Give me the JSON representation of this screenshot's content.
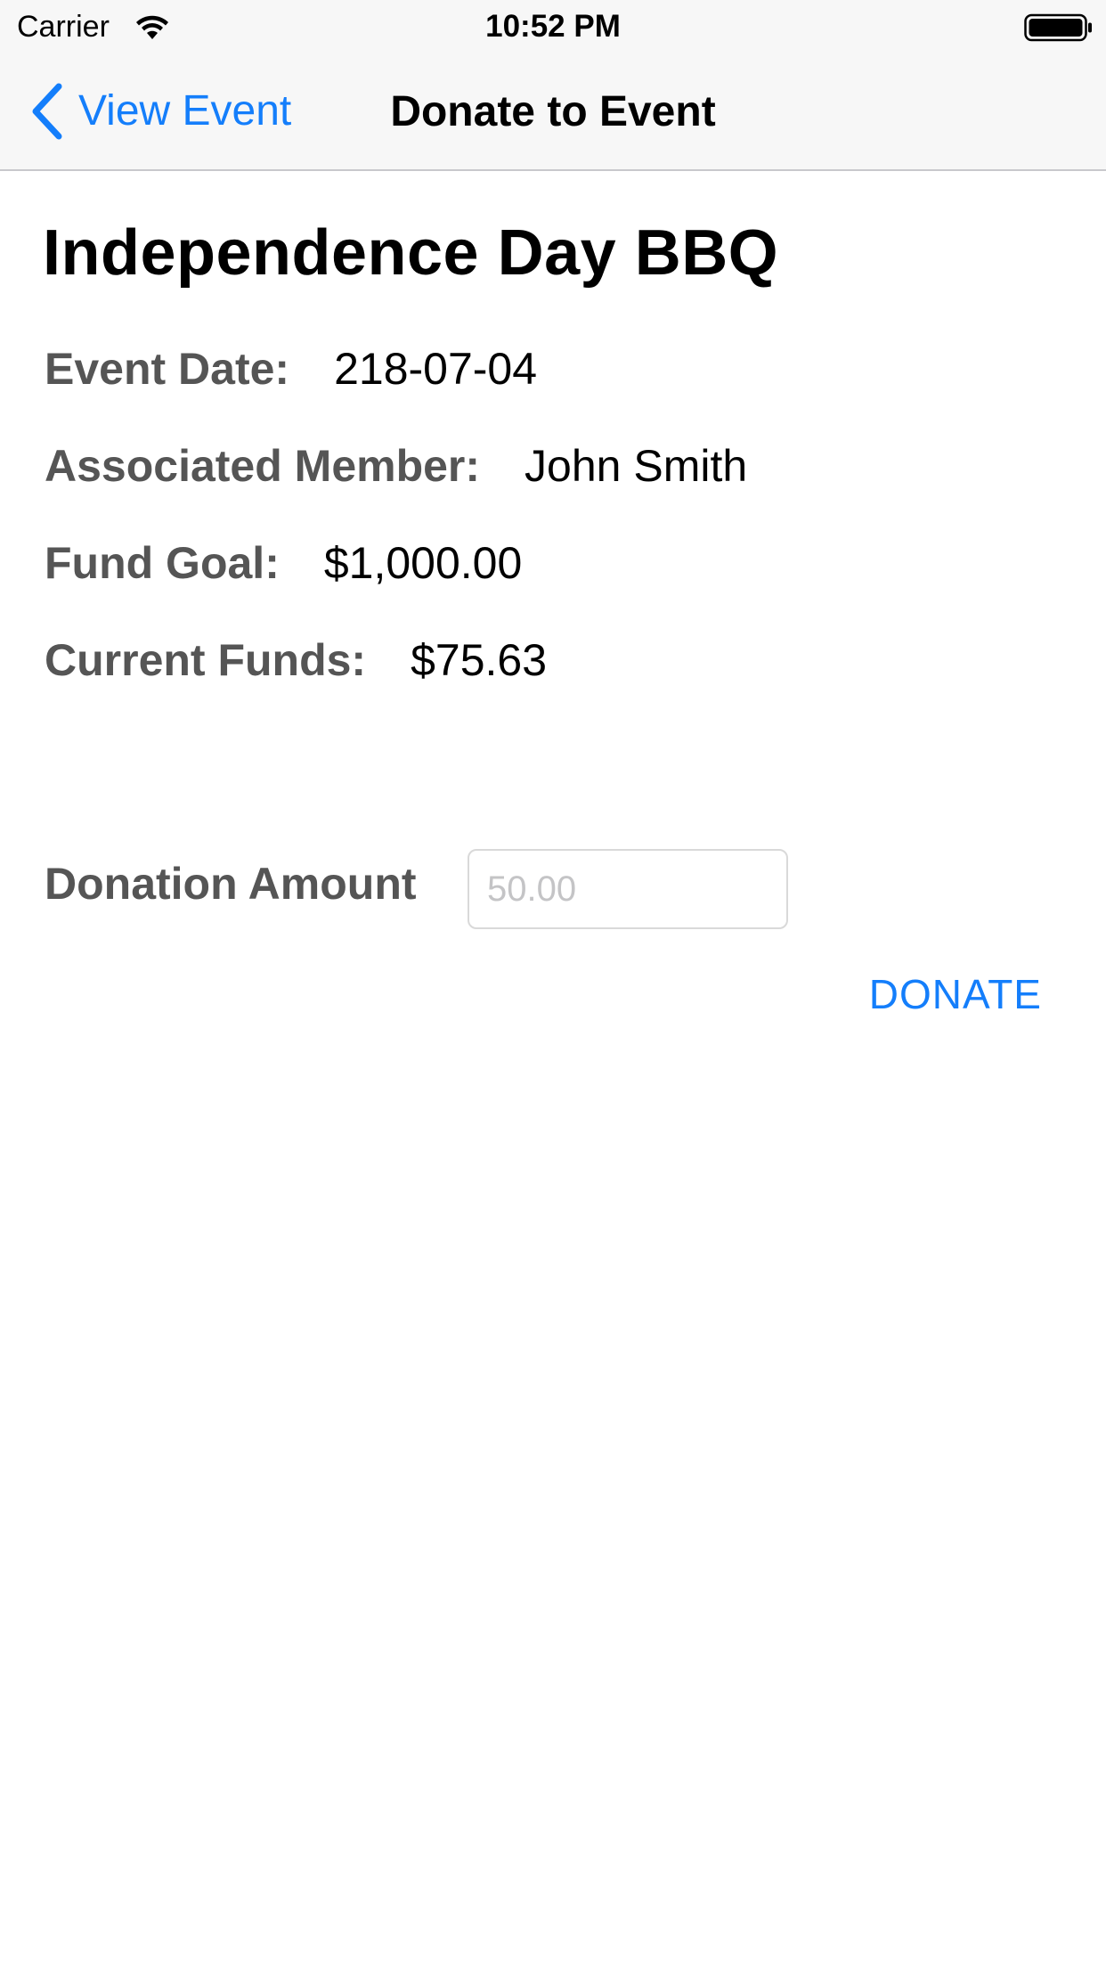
{
  "status_bar": {
    "carrier": "Carrier",
    "time": "10:52 PM",
    "wifi_icon": "wifi-icon",
    "battery_icon": "battery-icon"
  },
  "nav_bar": {
    "back_label": "View Event",
    "back_icon": "chevron-left-icon",
    "title": "Donate to Event"
  },
  "event": {
    "title": "Independence Day BBQ",
    "date_label": "Event Date:",
    "date_value": "218-07-04",
    "member_label": "Associated Member:",
    "member_value": "John Smith",
    "goal_label": "Fund Goal:",
    "goal_value": "$1,000.00",
    "funds_label": "Current Funds:",
    "funds_value": "$75.63"
  },
  "donation": {
    "label": "Donation Amount",
    "placeholder": "50.00",
    "value": "",
    "button_label": "DONATE"
  },
  "colors": {
    "accent": "#147efb",
    "label_gray": "#555555",
    "bar_background": "#f7f7f7"
  }
}
